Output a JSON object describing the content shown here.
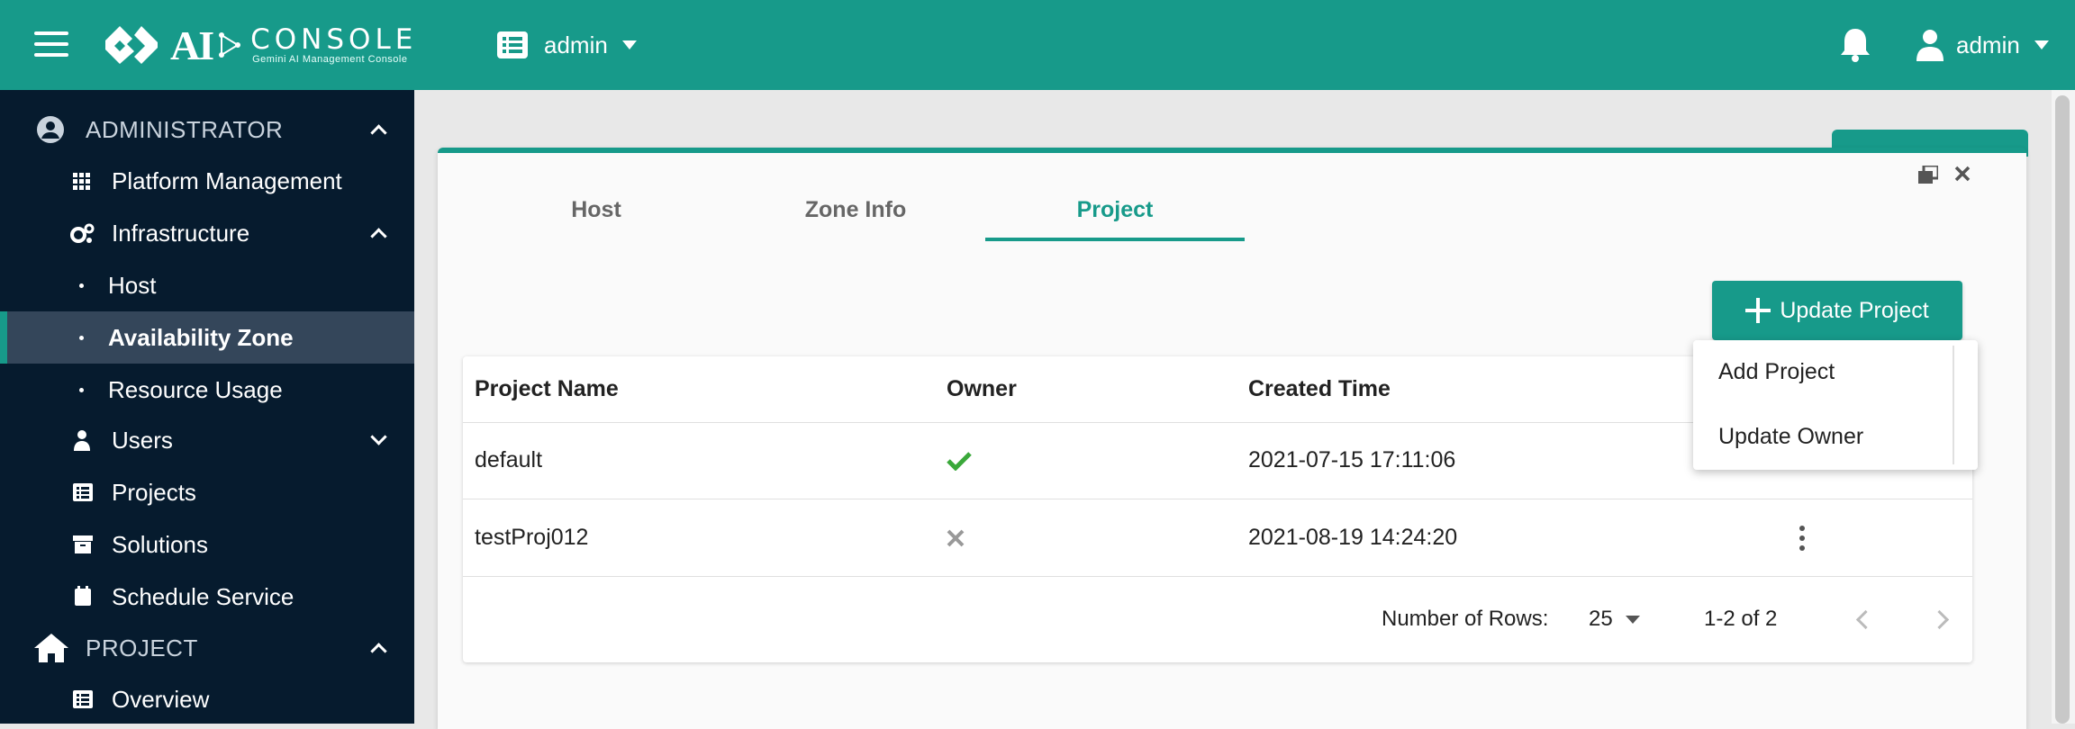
{
  "header": {
    "logo_ai": "AI",
    "logo_console": "CONSOLE",
    "logo_sub": "Gemini AI Management Console",
    "project_switch": "admin",
    "user": "admin"
  },
  "sidebar": {
    "admin_section": "ADMINISTRATOR",
    "platform_management": "Platform Management",
    "infrastructure": "Infrastructure",
    "host": "Host",
    "availability_zone": "Availability Zone",
    "resource_usage": "Resource Usage",
    "users": "Users",
    "projects": "Projects",
    "solutions": "Solutions",
    "schedule_service": "Schedule Service",
    "project_section": "PROJECT",
    "overview": "Overview"
  },
  "panel": {
    "tabs": [
      "Host",
      "Zone Info",
      "Project"
    ],
    "active_tab": "Project",
    "update_button": "Update Project",
    "table": {
      "headers": [
        "Project Name",
        "Owner",
        "Created Time"
      ],
      "rows": [
        {
          "name": "default",
          "owner": "check",
          "created": "2021-07-15 17:11:06"
        },
        {
          "name": "testProj012",
          "owner": "cross",
          "created": "2021-08-19 14:24:20"
        }
      ]
    },
    "footer": {
      "rows_label": "Number of Rows:",
      "rows_value": "25",
      "range": "1-2 of 2"
    }
  },
  "dropdown": {
    "options": [
      "Add Project",
      "Update Owner"
    ]
  },
  "colors": {
    "accent": "#179a8a",
    "sidebar": "#061b2e",
    "check": "#3aa83a",
    "cross": "#999999"
  }
}
